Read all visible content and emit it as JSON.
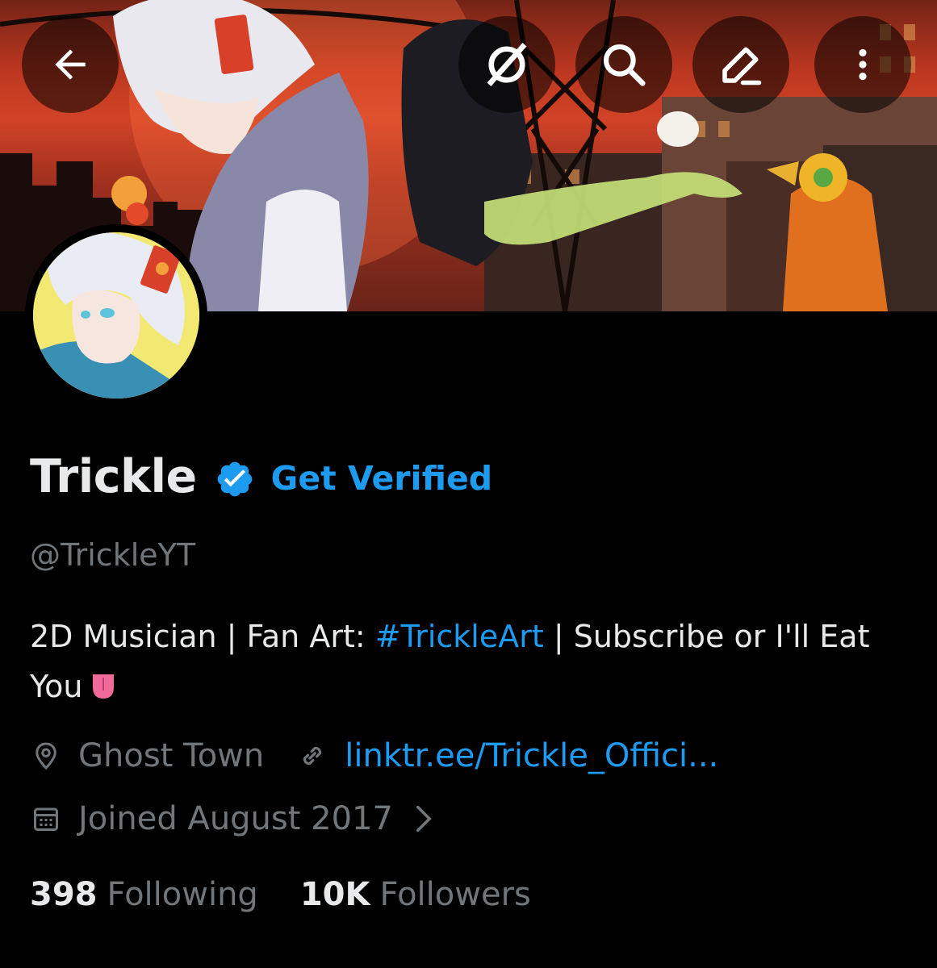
{
  "header": {
    "back_icon": "back-arrow-icon",
    "actions": [
      "grok-icon",
      "search-icon",
      "edit-icon",
      "more-icon"
    ]
  },
  "profile": {
    "display_name": "Trickle",
    "verified_label": "Get Verified",
    "handle": "@TrickleYT",
    "bio_part1": "2D Musician | Fan Art: ",
    "bio_hashtag": "#TrickleArt",
    "bio_part2": " | Subscribe or I'll Eat You",
    "location": "Ghost Town",
    "website": "linktr.ee/Trickle_Offici...",
    "joined": "Joined August 2017",
    "following_count": "398",
    "following_label": "Following",
    "followers_count": "10K",
    "followers_label": "Followers"
  },
  "colors": {
    "accent": "#1d9bf0",
    "secondary_text": "#71767b",
    "primary_text": "#e7e9ea",
    "background": "#000000"
  }
}
